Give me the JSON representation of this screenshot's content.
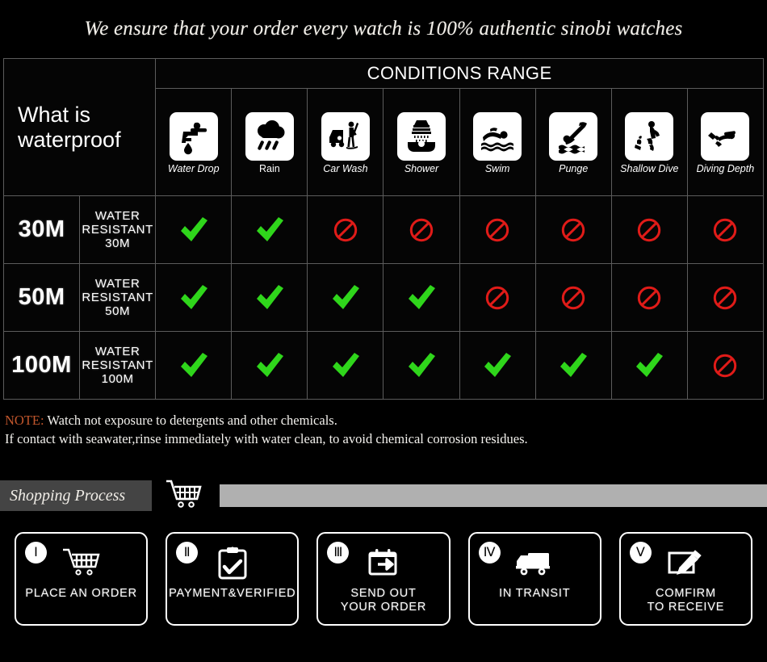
{
  "banner": {
    "title": "We ensure that your order every watch is 100% authentic sinobi watches"
  },
  "table": {
    "title_cell": "What is waterproof",
    "conditions_header": "CONDITIONS RANGE",
    "conditions": [
      {
        "label": "Water Drop",
        "icon": "faucet-drop-icon",
        "italic": true
      },
      {
        "label": "Rain",
        "icon": "rain-cloud-icon",
        "italic": false
      },
      {
        "label": "Car Wash",
        "icon": "car-wash-icon",
        "italic": true
      },
      {
        "label": "Shower",
        "icon": "shower-bath-icon",
        "italic": true
      },
      {
        "label": "Swim",
        "icon": "swimmer-icon",
        "italic": true
      },
      {
        "label": "Punge",
        "icon": "plunge-dive-icon",
        "italic": true
      },
      {
        "label": "Shallow\nDive",
        "icon": "shallow-dive-icon",
        "italic": true
      },
      {
        "label": "Diving\nDepth",
        "icon": "scuba-diver-icon",
        "italic": true
      }
    ],
    "rows": [
      {
        "depth": "30M",
        "resistance": "WATER RESISTANT  30M",
        "marks": [
          "yes",
          "yes",
          "no",
          "no",
          "no",
          "no",
          "no",
          "no"
        ]
      },
      {
        "depth": "50M",
        "resistance": "WATER RESISTANT 50M",
        "marks": [
          "yes",
          "yes",
          "yes",
          "yes",
          "no",
          "no",
          "no",
          "no"
        ]
      },
      {
        "depth": "100M",
        "resistance": "WATER RESISTANT  100M",
        "marks": [
          "yes",
          "yes",
          "yes",
          "yes",
          "yes",
          "yes",
          "yes",
          "no"
        ]
      }
    ]
  },
  "note": {
    "keyword": "NOTE:",
    "line1": " Watch not exposure to detergents and other chemicals.",
    "line2": "If contact with seawater,rinse immediately with water clean, to avoid chemical corrosion residues."
  },
  "process": {
    "heading": "Shopping Process",
    "cart_icon": "shopping-cart-icon",
    "steps": [
      {
        "numeral": "Ⅰ",
        "label": "PLACE AN ORDER",
        "icon": "shopping-cart-icon"
      },
      {
        "numeral": "Ⅱ",
        "label": "PAYMENT&VERIFIED",
        "icon": "clipboard-check-icon"
      },
      {
        "numeral": "Ⅲ",
        "label": "SEND OUT\nYOUR ORDER",
        "icon": "calendar-arrow-icon"
      },
      {
        "numeral": "Ⅳ",
        "label": "IN TRANSIT",
        "icon": "delivery-truck-icon"
      },
      {
        "numeral": "Ⅴ",
        "label": "COMFIRM\nTO RECEIVE",
        "icon": "sign-document-icon"
      }
    ]
  },
  "colors": {
    "check_green": "#2fd61b",
    "ban_red": "#e01b18",
    "note_keyword": "#c1562c",
    "header_bg": "#1c1c1e",
    "strip_gray": "#b0b0b0",
    "label_bar_gray": "#444444"
  }
}
